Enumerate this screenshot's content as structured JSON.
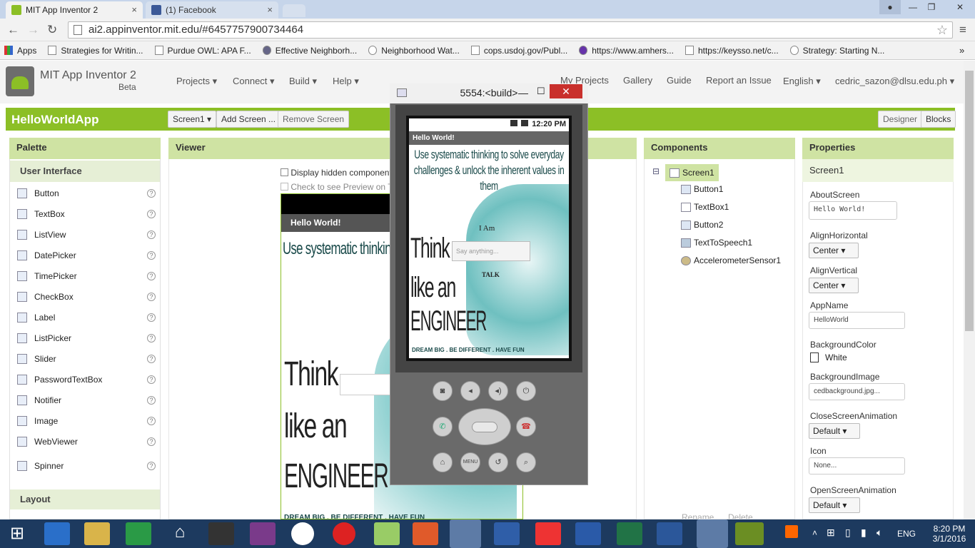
{
  "browser": {
    "tabs": [
      {
        "title": "MIT App Inventor 2",
        "close": "×"
      },
      {
        "title": "(1) Facebook",
        "close": "×"
      }
    ],
    "url": "ai2.appinventor.mit.edu/#6457757900734464",
    "bookmarks": [
      "Apps",
      "Strategies for Writin...",
      "Purdue OWL: APA F...",
      "Effective Neighborh...",
      "Neighborhood Wat...",
      "cops.usdoj.gov/Publ...",
      "https://www.amhers...",
      "https://keysso.net/c...",
      "Strategy: Starting N..."
    ],
    "more": "»"
  },
  "app": {
    "logo_title": "MIT App Inventor 2",
    "logo_sub": "Beta",
    "menus": [
      "Projects ▾",
      "Connect ▾",
      "Build ▾",
      "Help ▾"
    ],
    "right_links": [
      "My Projects",
      "Gallery",
      "Guide",
      "Report an Issue",
      "English ▾",
      "cedric_sazon@dlsu.edu.ph ▾"
    ],
    "project_name": "HelloWorldApp",
    "screen_select": "Screen1 ▾",
    "add_screen": "Add Screen ...",
    "remove_screen": "Remove Screen",
    "designer": "Designer",
    "blocks": "Blocks"
  },
  "palette": {
    "title": "Palette",
    "section": "User Interface",
    "items": [
      "Button",
      "TextBox",
      "ListView",
      "DatePicker",
      "TimePicker",
      "CheckBox",
      "Label",
      "ListPicker",
      "Slider",
      "PasswordTextBox",
      "Notifier",
      "Image",
      "WebViewer",
      "Spinner"
    ],
    "help": "?",
    "layout": "Layout"
  },
  "viewer": {
    "title": "Viewer",
    "check1": "Display hidden components in Viewer",
    "check2": "Check to see Preview on Tablet size.",
    "screen_title": "Hello World!"
  },
  "components": {
    "title": "Components",
    "collapse": "⊟",
    "tree": [
      "Screen1",
      "Button1",
      "TextBox1",
      "Button2",
      "TextToSpeech1",
      "AccelerometerSensor1"
    ],
    "rename": "Rename",
    "delete": "Delete"
  },
  "properties": {
    "title": "Properties",
    "component": "Screen1",
    "about_label": "AboutScreen",
    "about_value": "Hello World!",
    "alignh_label": "AlignHorizontal",
    "alignh_value": "Center ▾",
    "alignv_label": "AlignVertical",
    "alignv_value": "Center ▾",
    "appname_label": "AppName",
    "appname_value": "HelloWorld",
    "bgcolor_label": "BackgroundColor",
    "bgcolor_value": "White",
    "bgimage_label": "BackgroundImage",
    "bgimage_value": "cedbackground.jpg...",
    "closeanim_label": "CloseScreenAnimation",
    "closeanim_value": "Default ▾",
    "icon_label": "Icon",
    "icon_value": "None...",
    "openanim_label": "OpenScreenAnimation",
    "openanim_value": "Default ▾"
  },
  "emulator": {
    "title": "5554:<build>",
    "status_time": "12:20 PM",
    "app_title": "Hello World!",
    "headline": "Use systematic thinking to solve everyday challenges & unlock the inherent values in them",
    "think": "Think",
    "like": "like an",
    "engineer": "ENGINEER",
    "footer": "DREAM BIG . BE DIFFERENT . HAVE FUN",
    "button1": "I Am",
    "textbox_hint": "Say anything...",
    "talk": "TALK",
    "menu_key": "MENU"
  },
  "taskbar": {
    "lang": "ENG",
    "time": "8:20 PM",
    "date": "3/1/2016"
  },
  "colors": {
    "green": "#8cbf26",
    "palette_head": "#cfe3a3",
    "taskbar": "#1d3a5f"
  }
}
